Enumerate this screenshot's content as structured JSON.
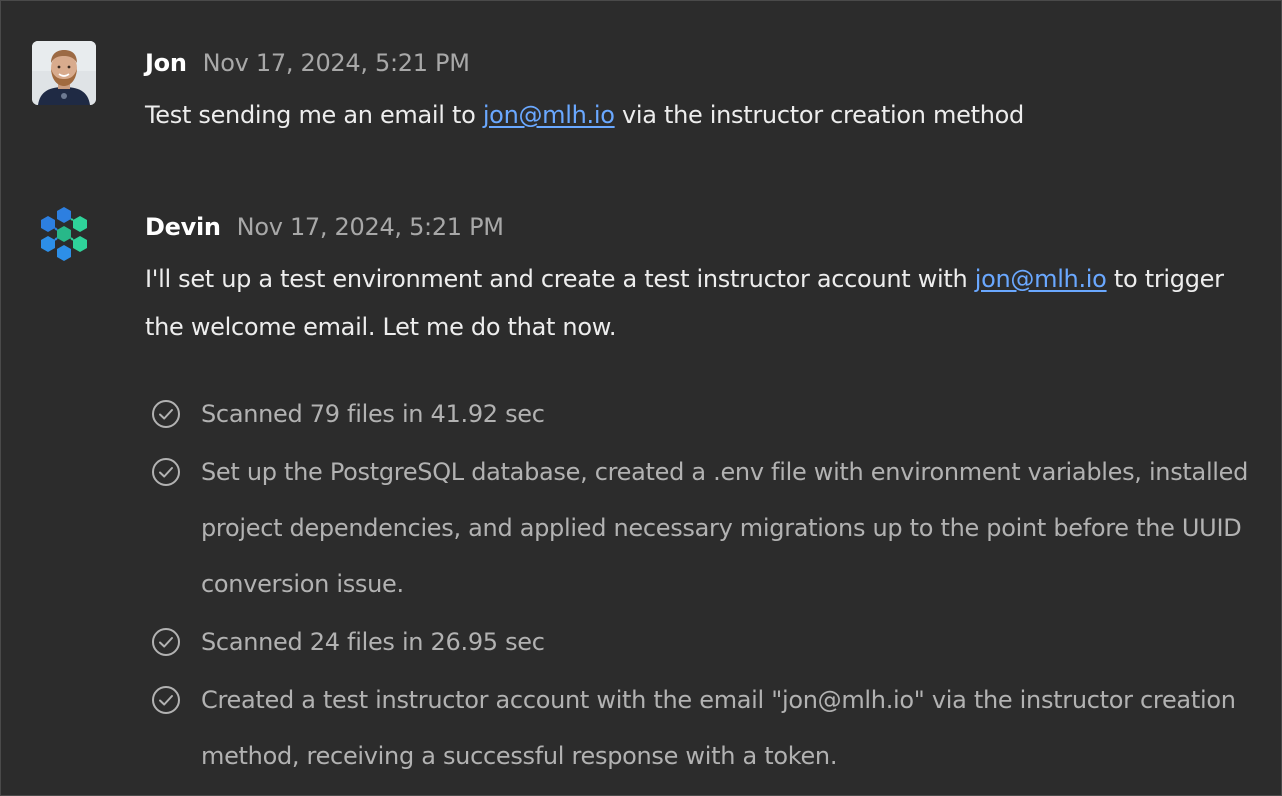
{
  "messages": [
    {
      "author": "Jon",
      "timestamp": "Nov 17, 2024, 5:21 PM",
      "text_before": "Test sending me an email to ",
      "link": "jon@mlh.io",
      "text_after": " via the instructor creation method",
      "avatar_icon": "user-photo-avatar"
    },
    {
      "author": "Devin",
      "timestamp": "Nov 17, 2024, 5:21 PM",
      "text_before": "I'll set up a test environment and create a test instructor account with ",
      "link": "jon@mlh.io",
      "text_after": " to trigger the welcome email. Let me do that now.",
      "avatar_icon": "devin-hexagon-logo",
      "steps": [
        "Scanned 79 files in 41.92 sec",
        "Set up the PostgreSQL database, created a .env file with environment variables, installed project dependencies, and applied necessary migrations up to the point before the UUID conversion issue.",
        "Scanned 24 files in 26.95 sec",
        "Created a test instructor account with the email \"jon@mlh.io\" via the instructor creation method, receiving a successful response with a token."
      ]
    }
  ],
  "colors": {
    "background": "#2c2c2c",
    "link": "#6aa8ff",
    "timestamp": "#a8a8a8",
    "step_text": "#b2b2b2",
    "logo_blue": "#2d7fe0",
    "logo_teal": "#2fd39a"
  },
  "icons": {
    "step_status": "check-circle-icon"
  }
}
